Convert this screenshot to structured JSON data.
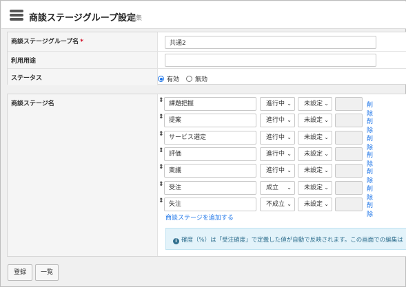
{
  "header": {
    "title": "商談ステージグループ設定",
    "subtitle": "編集",
    "icon": "database-icon"
  },
  "form": {
    "group_name_label": "商談ステージグループ名",
    "required_mark": "*",
    "group_name_value": "共通2",
    "usage_label": "利用用途",
    "usage_value": "",
    "status_label": "ステータス",
    "status_options": [
      "有効",
      "無効"
    ],
    "status_selected": "有効"
  },
  "stages": {
    "label": "商談ステージ名",
    "handle": "⇕",
    "delete_label": "削除",
    "items": [
      {
        "name": "課題把握",
        "state": "進行中",
        "setting": "未設定"
      },
      {
        "name": "提案",
        "state": "進行中",
        "setting": "未設定"
      },
      {
        "name": "サービス選定",
        "state": "進行中",
        "setting": "未設定"
      },
      {
        "name": "評価",
        "state": "進行中",
        "setting": "未設定"
      },
      {
        "name": "稟議",
        "state": "進行中",
        "setting": "未設定"
      },
      {
        "name": "受注",
        "state": "成立",
        "setting": "未設定"
      },
      {
        "name": "失注",
        "state": "不成立",
        "setting": "未設定"
      }
    ],
    "add_link": "商談ステージを追加する",
    "info_text": "確度（%）は「受注確度」で定義した値が自動で反映されます。この画面での編集は"
  },
  "footer": {
    "register_label": "登録",
    "list_label": "一覧"
  },
  "colors": {
    "link": "#1a73e8",
    "info_bg": "#e3f3fa",
    "info_text": "#31708f"
  }
}
